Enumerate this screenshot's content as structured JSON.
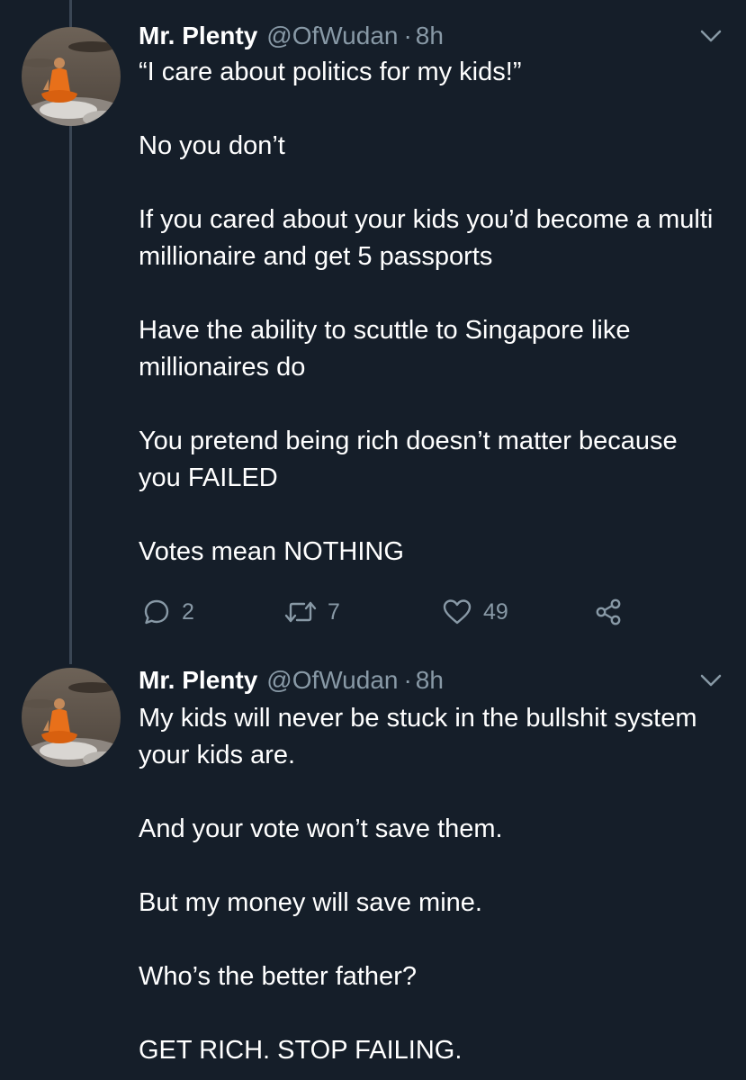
{
  "colors": {
    "background": "#151e29",
    "text_primary": "#ffffff",
    "text_secondary": "#8899a6",
    "thread_line": "#3a4654"
  },
  "tweets": [
    {
      "display_name": "Mr. Plenty",
      "handle": "@OfWudan",
      "separator": "·",
      "time": "8h",
      "avatar_icon": "avatar-meditating-monk",
      "paragraphs": [
        "“I care about politics for my kids!”",
        "No you don’t",
        "If you cared about your kids you’d become a multi millionaire and get 5 passports",
        "Have the ability to scuttle to Singapore like millionaires do",
        "You pretend being rich doesn’t matter because you FAILED",
        "Votes mean NOTHING"
      ],
      "actions": {
        "reply_icon": "reply-icon",
        "reply_count": "2",
        "retweet_icon": "retweet-icon",
        "retweet_count": "7",
        "like_icon": "heart-icon",
        "like_count": "49",
        "share_icon": "share-icon"
      }
    },
    {
      "display_name": "Mr. Plenty",
      "handle": "@OfWudan",
      "separator": "·",
      "time": "8h",
      "avatar_icon": "avatar-meditating-monk",
      "paragraphs": [
        "My kids will never be stuck in the bullshit system your kids are.",
        "And your vote won’t save them.",
        "But my money will save mine.",
        "Who’s the better father?",
        "GET RICH. STOP FAILING."
      ]
    }
  ]
}
